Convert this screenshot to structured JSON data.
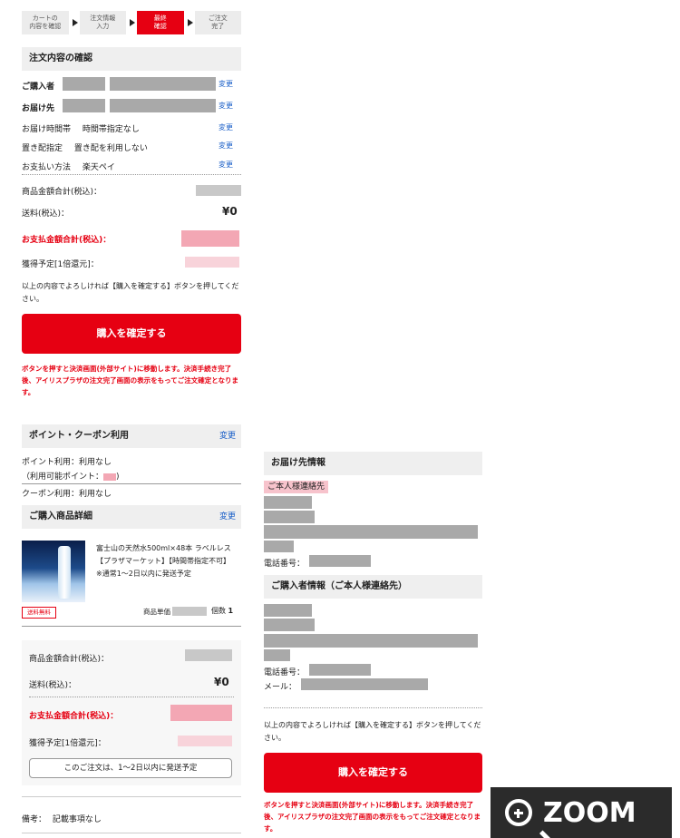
{
  "steps": [
    {
      "line1": "カートの",
      "line2": "内容を確認"
    },
    {
      "line1": "注文情報",
      "line2": "入力"
    },
    {
      "line1": "最終",
      "line2": "確認"
    },
    {
      "line1": "ご注文",
      "line2": "完了"
    }
  ],
  "active_step": 2,
  "order_confirm": {
    "title": "注文内容の確認",
    "buyer_label": "ご購入者",
    "ship_to_label": "お届け先",
    "edit": "変更",
    "delivery_time_label": "お届け時間帯",
    "delivery_time_value": "時間帯指定なし",
    "place_label": "置き配指定",
    "place_value": "置き配を利用しない",
    "payment_label": "お支払い方法",
    "payment_value": "楽天ペイ",
    "subtotal_label": "商品金額合計(税込)：",
    "shipping_label": "送料(税込)：",
    "shipping_value": "¥0",
    "total_label": "お支払金額合計(税込)：",
    "points_label": "獲得予定[1倍還元]：",
    "confirm_text": "以上の内容でよろしければ【購入を確定する】ボタンを押してください。",
    "confirm_button": "購入を確定する",
    "note": "ボタンを押すと決済画面(外部サイト)に移動します。決済手続き完了後、アイリスプラザの注文完了画面の表示をもってご注文確定となります。"
  },
  "points_coupon": {
    "title": "ポイント・クーポン利用",
    "edit": "変更",
    "point_use": "ポイント利用：利用なし",
    "available_points": "（利用可能ポイント：",
    "coupon_use": "クーポン利用：利用なし"
  },
  "product_detail": {
    "title": "ご購入商品詳細",
    "edit": "変更",
    "product_name": "富士山の天然水500ml×48本 ラベルレス【プラザマーケット】【時間帯指定不可】 ※通常1〜2日以内に発送予定",
    "free_shipping": "送料無料",
    "unit_price_label": "商品単価",
    "qty_label": "個数",
    "qty_value": "1"
  },
  "summary": {
    "subtotal_label": "商品金額合計(税込)：",
    "shipping_label": "送料(税込)：",
    "shipping_value": "¥0",
    "total_label": "お支払金額合計(税込)：",
    "points_label": "獲得予定[1倍還元]：",
    "ship_note": "このご注文は、1〜2日以内に発送予定"
  },
  "remarks": {
    "label": "備考：",
    "value": "記載事項なし"
  },
  "right": {
    "delivery_title": "お届け先情報",
    "contact_badge": "ご本人様連絡先",
    "phone_label": "電話番号：",
    "buyer_title": "ご購入者情報（ご本人様連絡先）",
    "mail_label": "メール：",
    "confirm_text": "以上の内容でよろしければ【購入を確定する】ボタンを押してください。",
    "confirm_button": "購入を確定する",
    "note": "ボタンを押すと決済画面(外部サイト)に移動します。決済手続き完了後、アイリスプラザの注文完了画面の表示をもってご注文確定となります。"
  },
  "zoom_label": "ZOOM"
}
